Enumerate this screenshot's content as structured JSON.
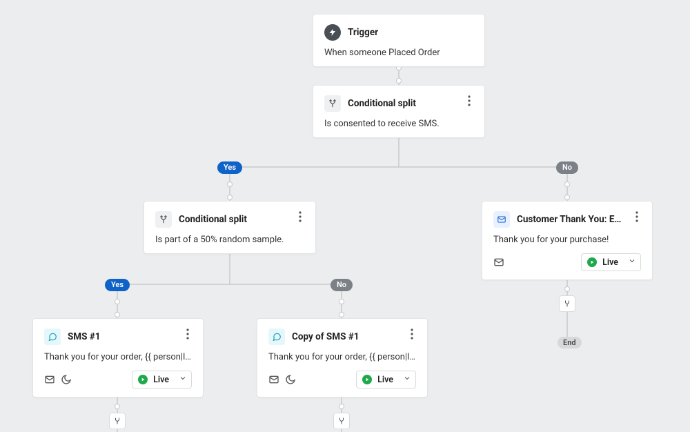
{
  "trigger": {
    "title": "Trigger",
    "desc": "When someone Placed Order"
  },
  "split1": {
    "title": "Conditional split",
    "desc": "Is consented to receive SMS."
  },
  "split2": {
    "title": "Conditional split",
    "desc": "Is part of a 50% random sample."
  },
  "email": {
    "title": "Customer Thank You: Email...",
    "desc": "Thank you for your purchase!",
    "status": "Live"
  },
  "sms1": {
    "title": "SMS #1",
    "desc": "Thank you for your order, {{ person|looku...",
    "status": "Live"
  },
  "sms2": {
    "title": "Copy of SMS #1",
    "desc": "Thank you for your order, {{ person|looku...",
    "status": "Live"
  },
  "labels": {
    "yes": "Yes",
    "no": "No",
    "end": "End"
  }
}
